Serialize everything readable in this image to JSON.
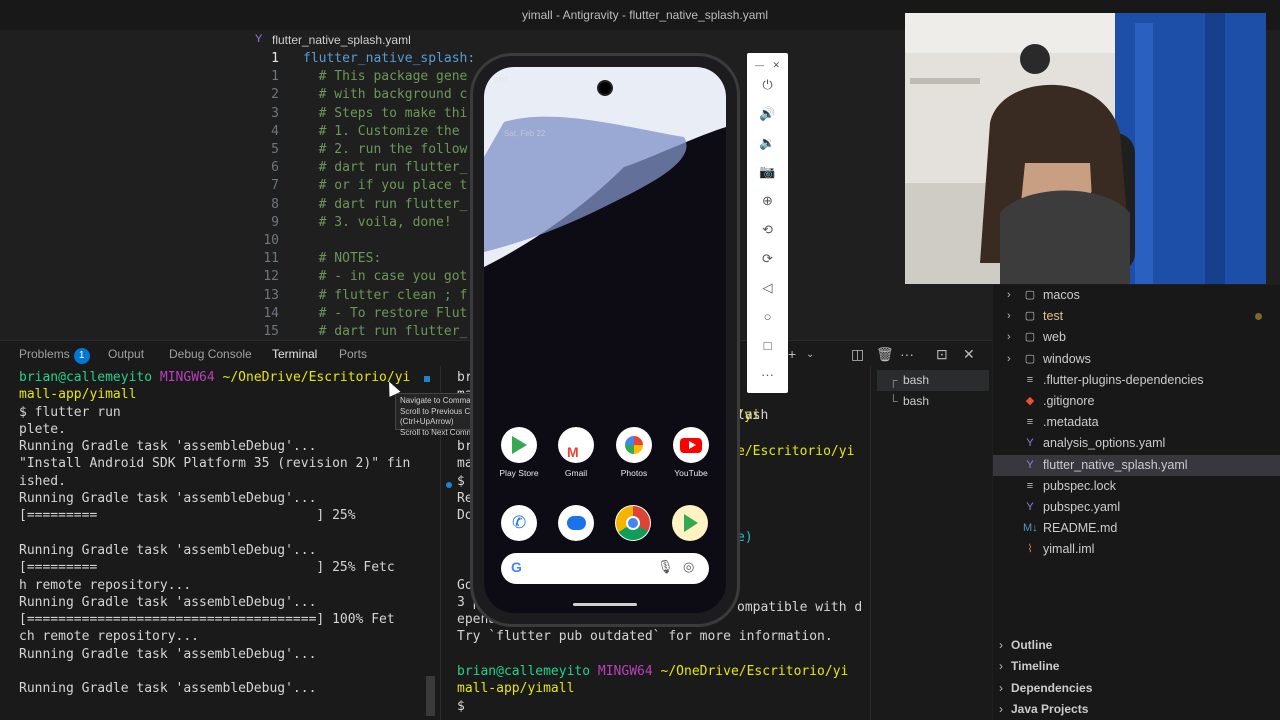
{
  "window": {
    "title": "yimall - Antigravity - flutter_native_splash.yaml"
  },
  "editor": {
    "tab_icon": "Y",
    "tab_label": "flutter_native_splash.yaml",
    "lines": [
      {
        "n": "1",
        "text": "flutter_native_splash:"
      },
      {
        "n": "1",
        "text": "  # This package gene"
      },
      {
        "n": "2",
        "text": "  # with background c"
      },
      {
        "n": "3",
        "text": "  # Steps to make thi"
      },
      {
        "n": "4",
        "text": "  # 1. Customize the "
      },
      {
        "n": "5",
        "text": "  # 2. run the follow"
      },
      {
        "n": "6",
        "text": "  # dart run flutter_"
      },
      {
        "n": "7",
        "text": "  # or if you place t"
      },
      {
        "n": "8",
        "text": "  # dart run flutter_"
      },
      {
        "n": "9",
        "text": "  # 3. voila, done!"
      },
      {
        "n": "10",
        "text": ""
      },
      {
        "n": "11",
        "text": "  # NOTES:"
      },
      {
        "n": "12",
        "text": "  # - in case you got"
      },
      {
        "n": "13",
        "text": "  # flutter clean ; f"
      },
      {
        "n": "14",
        "text": "  # - To restore Flut"
      },
      {
        "n": "15",
        "text": "  # dart run flutter_"
      }
    ]
  },
  "panel": {
    "tabs": {
      "problems": "Problems",
      "problems_count": "1",
      "output": "Output",
      "debug_console": "Debug Console",
      "terminal": "Terminal",
      "ports": "Ports"
    },
    "terminal1": [
      {
        "a": "brian@callemeyito",
        "b": "MINGW64",
        "c": "~/OneDrive/Escritorio/yi"
      },
      {
        "c": "mall-app/yimall"
      },
      {
        "t": "$ flutter run"
      },
      {
        "t": "plete."
      },
      {
        "t": "Running Gradle task 'assembleDebug'..."
      },
      {
        "t": "\"Install Android SDK Platform 35 (revision 2)\" fin"
      },
      {
        "t": "ished."
      },
      {
        "t": "Running Gradle task 'assembleDebug'..."
      },
      {
        "t": "[=========                            ] 25%"
      },
      {
        "t": ""
      },
      {
        "t": "Running Gradle task 'assembleDebug'..."
      },
      {
        "t": "[=========                            ] 25% Fetc"
      },
      {
        "t": "h remote repository..."
      },
      {
        "t": "Running Gradle task 'assembleDebug'..."
      },
      {
        "t": "[=====================================] 100% Fet"
      },
      {
        "t": "ch remote repository..."
      },
      {
        "t": "Running Gradle task 'assembleDebug'..."
      },
      {
        "t": ""
      },
      {
        "t": "Running Gradle task 'assembleDebug'..."
      }
    ],
    "terminal2": [
      {
        "t": "br"
      },
      {
        "t": "ma"
      },
      {
        "t": "$ "
      },
      {
        "t": ""
      },
      {
        "t": "br"
      },
      {
        "t": "ma"
      },
      {
        "t": "$ "
      },
      {
        "t": "Re"
      },
      {
        "t": "Do"
      },
      {
        "t": ""
      },
      {
        "t": ""
      },
      {
        "t": ""
      },
      {
        "t": "Go"
      },
      {
        "t": "3 p"
      },
      {
        "t": "ependency constraints."
      },
      {
        "t": "Try `flutter pub outdated` for more information."
      },
      {
        "t": ""
      },
      {
        "a": "brian@callemeyito",
        "b": "MINGW64",
        "c": "~/OneDrive/Escritorio/yi"
      },
      {
        "c": "mall-app/yimall"
      },
      {
        "t": "$ "
      }
    ],
    "terminal2_fragments": {
      "prompt_tail": "orio/yi",
      "lash": "lash",
      "path_tail": "e/Escritorio/yi",
      "paren": "e)",
      "compat": "ompatible with d"
    },
    "terminal_list": [
      "bash",
      "bash"
    ]
  },
  "tooltip": {
    "line1": "Navigate to Command",
    "line2": "Scroll to Previous Command (Ctrl+UpArrow)",
    "line3": "Scroll to Next Command (Ctrl+DownArrow)"
  },
  "explorer": {
    "items": [
      {
        "label": "macos",
        "type": "folder"
      },
      {
        "label": "test",
        "type": "folder",
        "modified": true
      },
      {
        "label": "web",
        "type": "folder"
      },
      {
        "label": "windows",
        "type": "folder"
      },
      {
        "label": ".flutter-plugins-dependencies",
        "type": "file"
      },
      {
        "label": ".gitignore",
        "type": "git"
      },
      {
        "label": ".metadata",
        "type": "file"
      },
      {
        "label": "analysis_options.yaml",
        "type": "yaml"
      },
      {
        "label": "flutter_native_splash.yaml",
        "type": "yaml",
        "active": true
      },
      {
        "label": "pubspec.lock",
        "type": "file"
      },
      {
        "label": "pubspec.yaml",
        "type": "yaml"
      },
      {
        "label": "README.md",
        "type": "md"
      },
      {
        "label": "yimall.iml",
        "type": "rss"
      }
    ],
    "sections": [
      "Outline",
      "Timeline",
      "Dependencies",
      "Java Projects"
    ]
  },
  "phone": {
    "status_time": "3:07",
    "date": "Sat, Feb 22",
    "apps": [
      {
        "label": "Play Store",
        "color": "#34a853"
      },
      {
        "label": "Gmail",
        "color": "#ea4335"
      },
      {
        "label": "Photos",
        "color": "#fbbc05"
      },
      {
        "label": "YouTube",
        "color": "#ff0000"
      }
    ],
    "dock": [
      {
        "name": "phone",
        "color": "#1a73e8"
      },
      {
        "name": "messages",
        "color": "#1a73e8"
      },
      {
        "name": "chrome",
        "color": "#db4437"
      },
      {
        "name": "play-games",
        "color": "#fbbc05"
      }
    ],
    "search_g": "G"
  },
  "colors": {
    "accent": "#0078d4",
    "prompt_user": "#23d18b",
    "prompt_host": "#bc3fbc",
    "prompt_path": "#e5e510"
  }
}
